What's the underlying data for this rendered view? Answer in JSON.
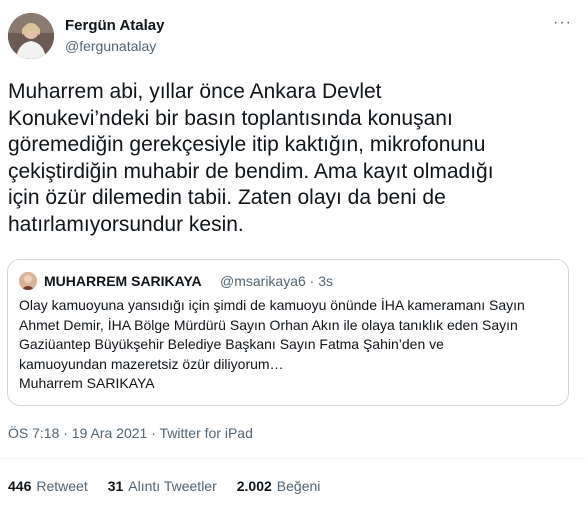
{
  "author": {
    "display_name": "Fergün Atalay",
    "handle": "@fergunatalay"
  },
  "more_icon": "more-dots-icon",
  "tweet": {
    "text": "Muharrem abi, yıllar önce Ankara Devlet\nKonukevi’ndeki bir basın toplantısında konuşanı\ngöremediğin gerekçesiyle itip kaktığın, mikrofonunu\nçekiştirdiğin muhabir de bendim. Ama kayıt olmadığı\niçin özür dilemedin tabii. Zaten olayı da beni de\nhatırlamıyorsundur kesin."
  },
  "quoted": {
    "display_name": "MUHARREM SARIKAYA",
    "meta": "@msarikaya6 · 3s",
    "text": "Olay kamuoyuna yansıdığı için şimdi de kamuoyu önünde İHA kameramanı Sayın\nAhmet Demir, İHA Bölge Mürdürü Sayın Orhan Akın ile olaya tanıklık eden Sayın\nGaziüantep Büyükşehir Belediye Başkanı Sayın Fatma Şahin’den ve\nkamuoyundan  mazeretsiz özür diliyorum…\nMuharrem SARIKAYA"
  },
  "meta_line": "ÖS 7:18 · 19 Ara 2021 · Twitter for iPad",
  "stats": [
    {
      "count": "446",
      "label": "Retweet"
    },
    {
      "count": "31",
      "label": "Alıntı Tweetler"
    },
    {
      "count": "2.002",
      "label": "Beğeni"
    }
  ],
  "colors": {
    "text": "#0f1419",
    "secondary": "#536471",
    "border": "#cfd9de"
  }
}
